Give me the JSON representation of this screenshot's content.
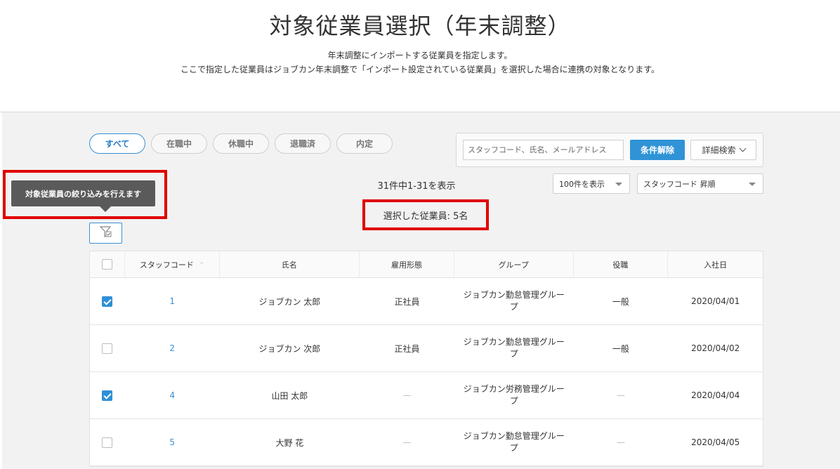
{
  "header": {
    "title": "対象従業員選択（年末調整）",
    "description_line1": "年末調整にインポートする従業員を指定します。",
    "description_line2": "ここで指定した従業員はジョブカン年末調整で「インポート設定されている従業員」を選択した場合に連携の対象となります。"
  },
  "tabs": [
    {
      "label": "すべて",
      "active": true
    },
    {
      "label": "在職中",
      "active": false
    },
    {
      "label": "休職中",
      "active": false
    },
    {
      "label": "退職済",
      "active": false
    },
    {
      "label": "内定",
      "active": false
    }
  ],
  "search": {
    "placeholder": "スタッフコード、氏名、メールアドレス",
    "clear_label": "条件解除",
    "detail_label": "詳細検索"
  },
  "results": {
    "count_text": "31件中1-31を表示",
    "per_page": "100件を表示",
    "sort": "スタッフコード 昇順",
    "selected_text": "選択した従業員: 5名"
  },
  "tooltip": {
    "text": "対象従業員の絞り込みを行えます"
  },
  "table": {
    "headers": [
      "スタッフコード",
      "氏名",
      "雇用形態",
      "グループ",
      "役職",
      "入社日"
    ],
    "sort_indicator": "^",
    "rows": [
      {
        "checked": true,
        "code": "1",
        "name": "ジョブカン 太郎",
        "employment": "正社員",
        "group": "ジョブカン勤怠管理グループ",
        "position": "一般",
        "join_date": "2020/04/01"
      },
      {
        "checked": false,
        "code": "2",
        "name": "ジョブカン 次郎",
        "employment": "正社員",
        "group": "ジョブカン勤怠管理グループ",
        "position": "一般",
        "join_date": "2020/04/02"
      },
      {
        "checked": true,
        "code": "4",
        "name": "山田 太郎",
        "employment": "—",
        "group": "ジョブカン労務管理グループ",
        "position": "—",
        "join_date": "2020/04/04"
      },
      {
        "checked": false,
        "code": "5",
        "name": "大野 花",
        "employment": "—",
        "group": "ジョブカン勤怠管理グループ",
        "position": "—",
        "join_date": "2020/04/05"
      }
    ]
  },
  "colors": {
    "accent": "#2f93d6",
    "highlight_border": "#e00000",
    "tooltip_bg": "#5a5a5a"
  },
  "icons": {
    "filter": "filter-icon",
    "chevron": "chevron-down-icon"
  }
}
